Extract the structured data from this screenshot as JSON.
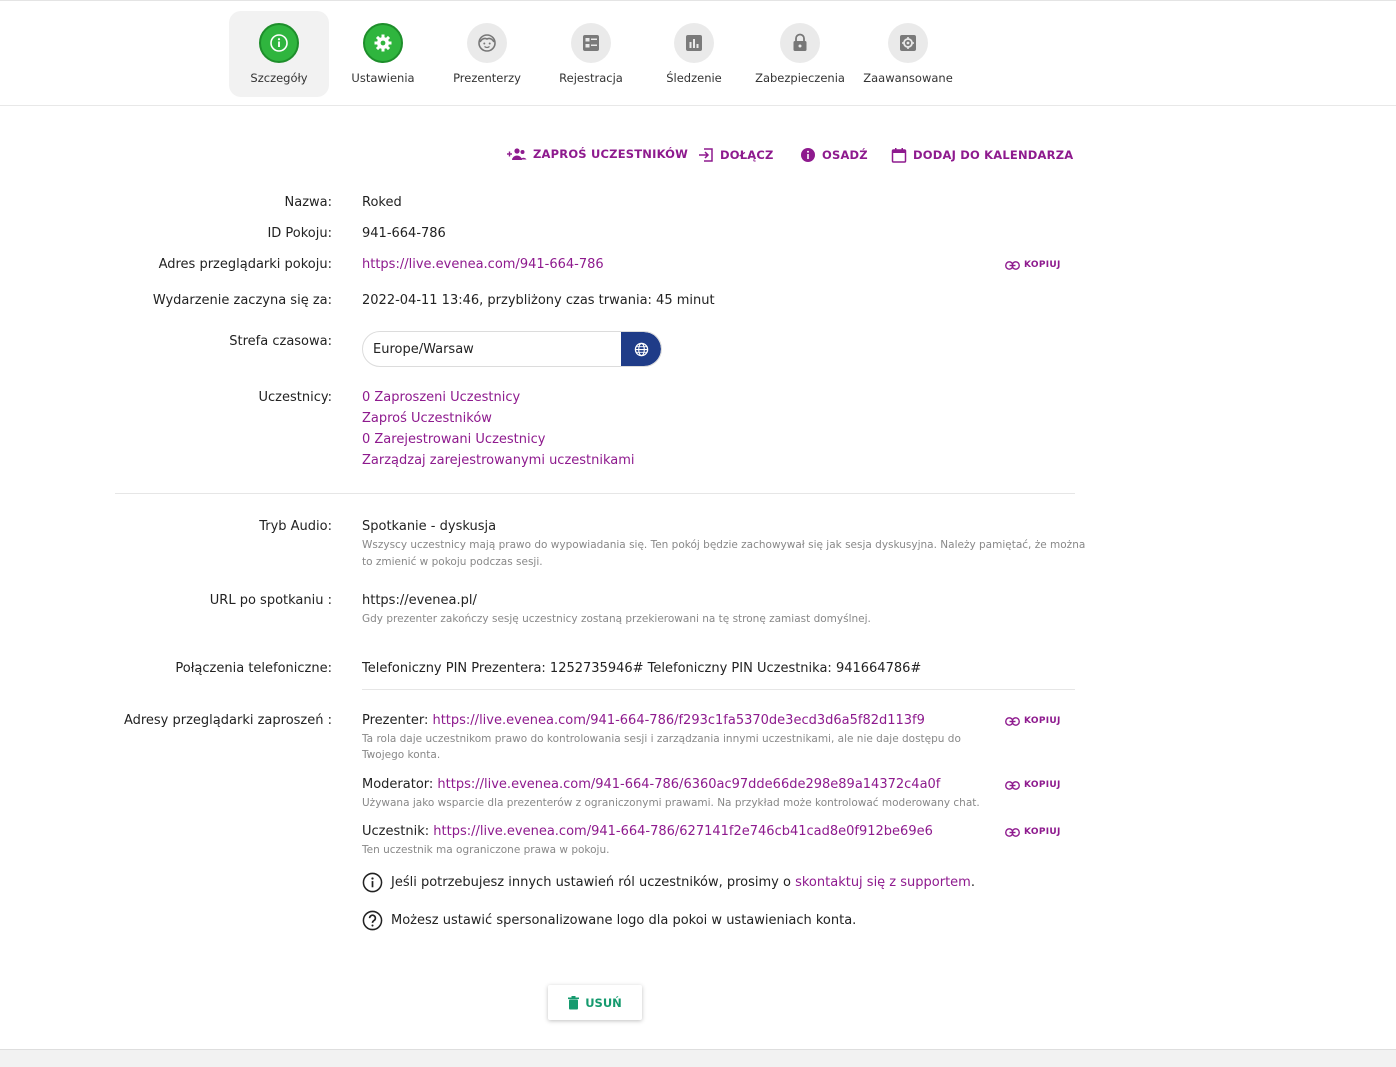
{
  "tabs": [
    {
      "label": "Szczegóły",
      "icon": "info-icon"
    },
    {
      "label": "Ustawienia",
      "icon": "gear-icon"
    },
    {
      "label": "Prezenterzy",
      "icon": "face-icon"
    },
    {
      "label": "Rejestracja",
      "icon": "form-icon"
    },
    {
      "label": "Śledzenie",
      "icon": "bar-chart-icon"
    },
    {
      "label": "Zabezpieczenia",
      "icon": "lock-icon"
    },
    {
      "label": "Zaawansowane",
      "icon": "advanced-gear-icon"
    }
  ],
  "actions": {
    "invite": "ZAPROŚ UCZESTNIKÓW",
    "join": "DOŁĄCZ",
    "embed": "OSADŹ",
    "calendar": "DODAJ DO KALENDARZA"
  },
  "copy_label": "KOPIUJ",
  "details": {
    "name_label": "Nazwa:",
    "name": "Roked",
    "room_id_label": "ID Pokoju:",
    "room_id": "941-664-786",
    "browser_url_label": "Adres przeglądarki pokoju:",
    "browser_url": "https://live.evenea.com/941-664-786",
    "start_label": "Wydarzenie zaczyna się za:",
    "start": "2022-04-11 13:46, przybliżony czas trwania: 45 minut",
    "timezone_label": "Strefa czasowa:",
    "timezone": "Europe/Warsaw",
    "participants_label": "Uczestnicy:",
    "participants_links": [
      "0 Zaproszeni Uczestnicy",
      "Zaproś Uczestników",
      "0 Zarejestrowani Uczestnicy",
      "Zarządzaj zarejestrowanymi uczestnikami"
    ]
  },
  "audio": {
    "label": "Tryb Audio:",
    "value": "Spotkanie - dyskusja",
    "note_line1": "Wszyscy uczestnicy mają prawo do wypowiadania się. Ten pokój będzie zachowywał się jak sesja dyskusyjna. Należy pamiętać, że można",
    "note_line2": "to zmienić w pokoju podczas sesji."
  },
  "after_url": {
    "label": "URL po spotkaniu :",
    "value": "https://evenea.pl/",
    "note": "Gdy prezenter zakończy sesję uczestnicy zostaną przekierowani na tę stronę zamiast domyślnej."
  },
  "phone": {
    "label": "Połączenia telefoniczne:",
    "value": "Telefoniczny PIN Prezentera: 1252735946# Telefoniczny PIN Uczestnika: 941664786#"
  },
  "invite_urls": {
    "label": "Adresy przeglądarki zaproszeń :",
    "presenter_label": "Prezenter:",
    "presenter_url": "https://live.evenea.com/941-664-786/f293c1fa5370de3ecd3d6a5f82d113f9",
    "presenter_note_line1": "Ta rola daje uczestnikom prawo do kontrolowania sesji i zarządzania innymi uczestnikami, ale nie daje dostępu do",
    "presenter_note_line2": "Twojego konta.",
    "moderator_label": "Moderator:",
    "moderator_url": "https://live.evenea.com/941-664-786/6360ac97dde66de298e89a14372c4a0f",
    "moderator_note": "Używana jako wsparcie dla prezenterów z ograniczonymi prawami. Na przykład może kontrolować moderowany chat.",
    "attendee_label": "Uczestnik:",
    "attendee_url": "https://live.evenea.com/941-664-786/627141f2e746cb41cad8e0f912be69e6",
    "attendee_note": "Ten uczestnik ma ograniczone prawa w pokoju."
  },
  "info1_text": "Jeśli potrzebujesz innych ustawień ról uczestników, prosimy o",
  "info1_link": "skontaktuj się z supportem",
  "info1_end": ".",
  "info2_text": "Możesz ustawić spersonalizowane logo dla pokoi w ustawieniach konta.",
  "delete_label": "USUŃ",
  "colors": {
    "accent": "#8e1a8e",
    "active_tab": "#2fb53e",
    "globe_button": "#1f3c88",
    "delete_text": "#159a6e"
  }
}
